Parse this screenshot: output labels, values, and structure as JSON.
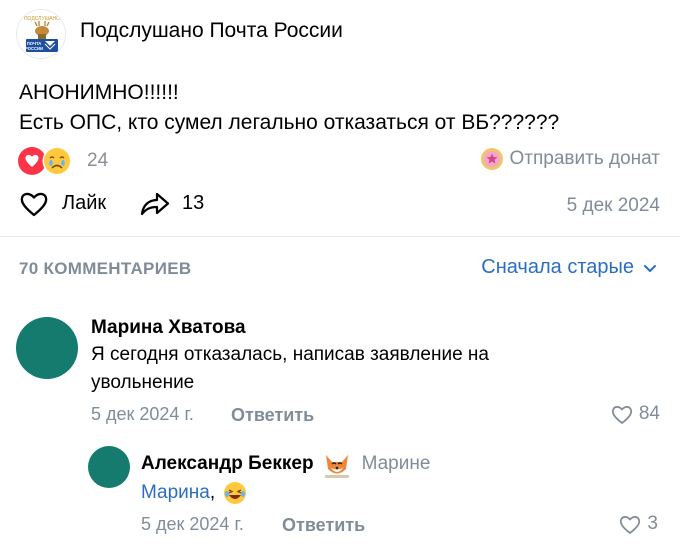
{
  "post": {
    "group_name": "Подслушано Почта России",
    "logo_text_top": "ПОЧТА",
    "logo_text_bottom": "РОССИИ",
    "logo_banner": "ПОДСЛУШАНО",
    "text_line1": "АНОНИМНО!!!!!!",
    "text_line2": "Есть ОПС, кто сумел легально отказаться от ВБ??????",
    "reactions_count": "24",
    "donate_label": "Отправить донат",
    "like_label": "Лайк",
    "share_count": "13",
    "date": "5 дек 2024"
  },
  "comments_section": {
    "count_label": "70 КОММЕНТАРИЕВ",
    "sort_label": "Сначала старые",
    "comments": [
      {
        "author": "Марина Хватова",
        "text_line1": "Я сегодня отказалась, написав заявление на",
        "text_line2": "увольнение",
        "date": "5 дек 2024 г.",
        "reply_label": "Ответить",
        "likes": "84"
      },
      {
        "author": "Александр Беккер",
        "reply_to": "Марине",
        "mention": "Марина",
        "text_after": ",",
        "date": "5 дек 2024 г.",
        "reply_label": "Ответить",
        "likes": "3"
      }
    ]
  },
  "colors": {
    "accent": "#2a6ec2",
    "muted": "#818c99",
    "avatar": "#147b6e",
    "like_red": "#e64646"
  },
  "icons": [
    "heart-reaction-icon",
    "crying-emoji-icon",
    "donate-coin-icon",
    "like-heart-icon",
    "share-arrow-icon",
    "chevron-down-icon",
    "fox-sticker-icon",
    "laughing-emoji-icon",
    "comment-like-heart-icon"
  ]
}
